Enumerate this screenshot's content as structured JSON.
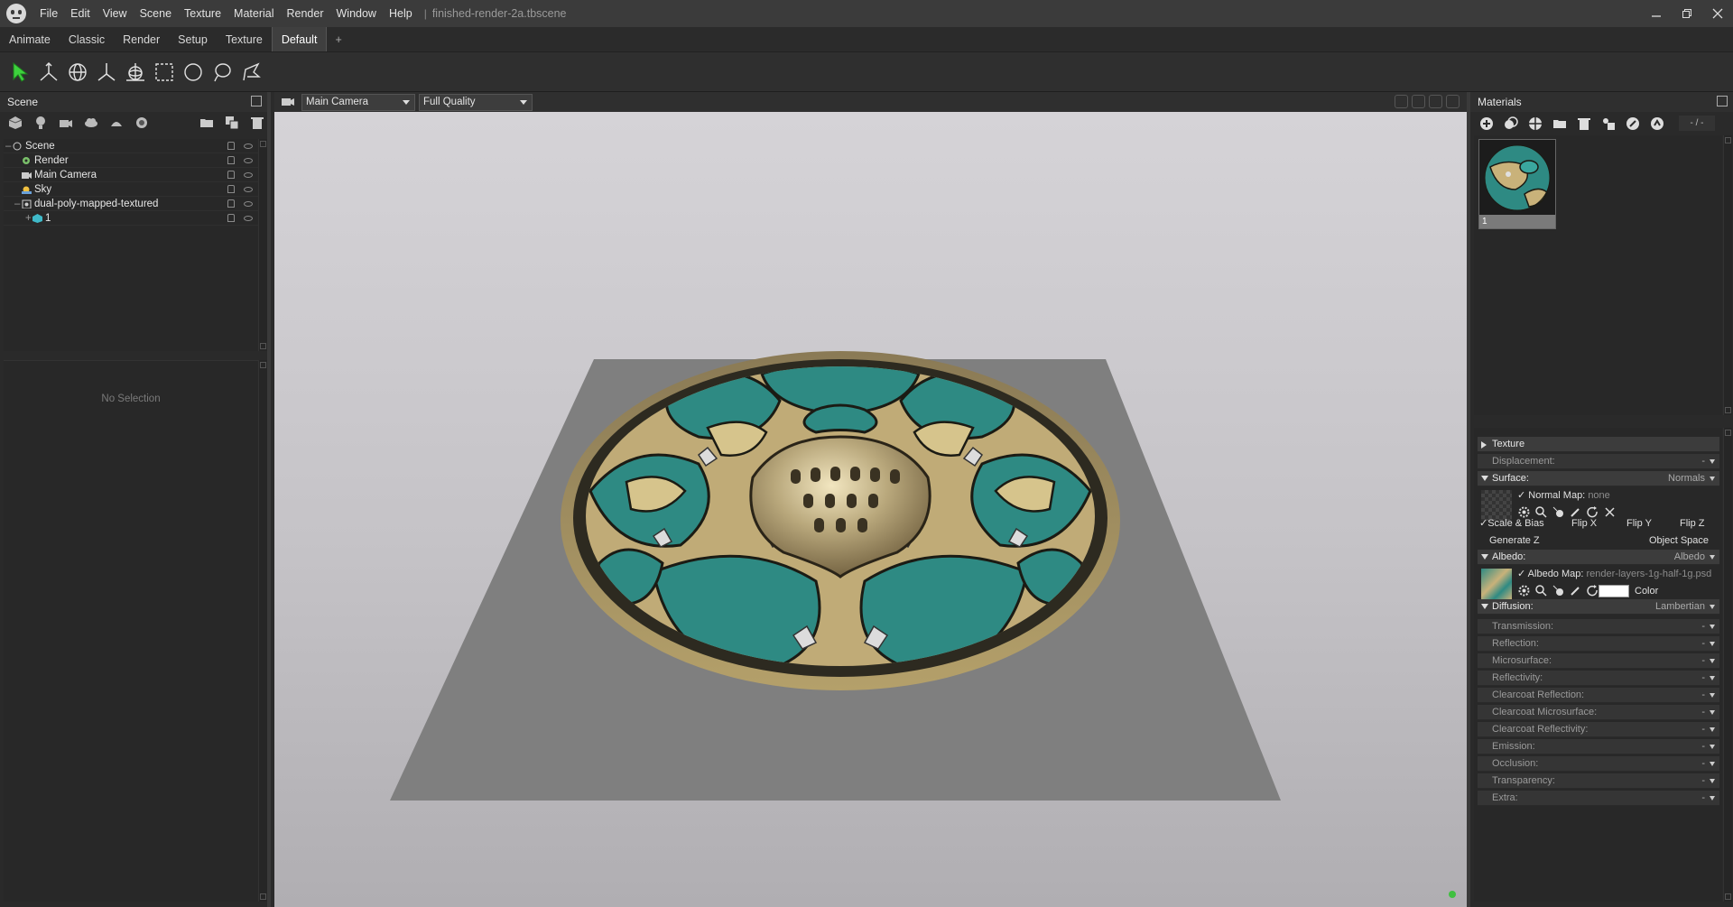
{
  "menubar": {
    "items": [
      "File",
      "Edit",
      "View",
      "Scene",
      "Texture",
      "Material",
      "Render",
      "Window",
      "Help"
    ],
    "separator": "|",
    "document_title": "finished-render-2a.tbscene"
  },
  "workspace_tabs": {
    "items": [
      "Animate",
      "Classic",
      "Render",
      "Setup",
      "Texture",
      "Default"
    ],
    "active": "Default",
    "add_label": "+"
  },
  "scene_panel": {
    "title": "Scene",
    "tree": [
      {
        "label": "Scene",
        "icon": "scene-root-icon"
      },
      {
        "label": "Render",
        "icon": "render-gear-icon"
      },
      {
        "label": "Main Camera",
        "icon": "camera-icon"
      },
      {
        "label": "Sky",
        "icon": "sky-sun-icon"
      },
      {
        "label": "dual-poly-mapped-textured",
        "icon": "object-icon"
      },
      {
        "label": "1",
        "icon": "mesh-cube-icon"
      }
    ],
    "no_selection": "No Selection"
  },
  "viewport": {
    "camera": "Main Camera",
    "quality": "Full Quality"
  },
  "materials_panel": {
    "title": "Materials",
    "counter": "- / -",
    "material_name": "1",
    "sections": {
      "texture": "Texture",
      "displacement": {
        "label": "Displacement:",
        "value": "-"
      },
      "surface": {
        "label": "Surface:",
        "value": "Normals"
      },
      "normal_map": {
        "label": "Normal Map:",
        "value": "none"
      },
      "scale_bias": "Scale & Bias",
      "flip_x": "Flip X",
      "flip_y": "Flip Y",
      "flip_z": "Flip Z",
      "generate_z": "Generate Z",
      "object_space": "Object Space",
      "albedo": {
        "label": "Albedo:",
        "value": "Albedo"
      },
      "albedo_map": {
        "label": "Albedo Map:",
        "value": "render-layers-1g-half-1g.psd"
      },
      "color_label": "Color",
      "color_value": "#ffffff",
      "diffusion": {
        "label": "Diffusion:",
        "value": "Lambertian"
      }
    },
    "collapsed_sections": [
      {
        "label": "Transmission:",
        "value": "-"
      },
      {
        "label": "Reflection:",
        "value": "-"
      },
      {
        "label": "Microsurface:",
        "value": "-"
      },
      {
        "label": "Reflectivity:",
        "value": "-"
      },
      {
        "label": "Clearcoat Reflection:",
        "value": "-"
      },
      {
        "label": "Clearcoat Microsurface:",
        "value": "-"
      },
      {
        "label": "Clearcoat Reflectivity:",
        "value": "-"
      },
      {
        "label": "Emission:",
        "value": "-"
      },
      {
        "label": "Occlusion:",
        "value": "-"
      },
      {
        "label": "Transparency:",
        "value": "-"
      },
      {
        "label": "Extra:",
        "value": "-"
      }
    ]
  },
  "colors": {
    "teal": "#2f8f88",
    "gold": "#c9b27a",
    "accent_green": "#40c040"
  }
}
